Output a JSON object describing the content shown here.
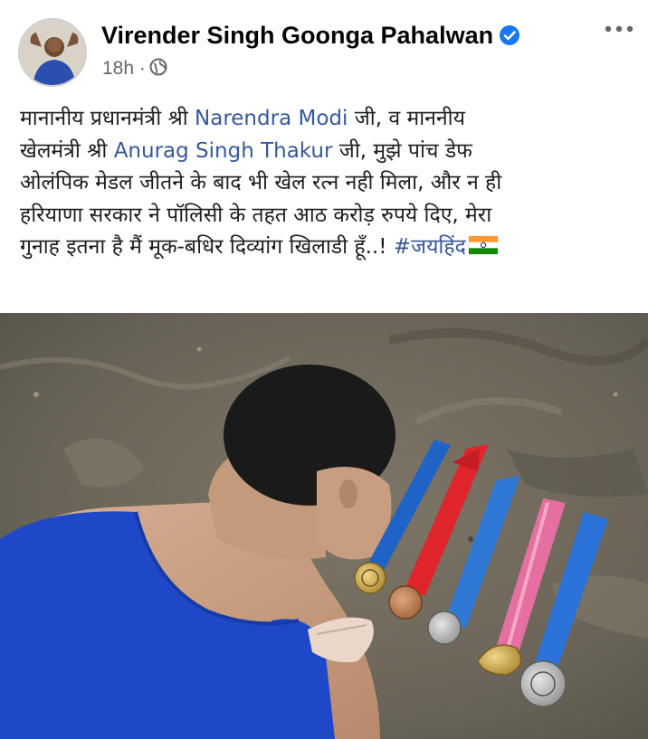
{
  "post": {
    "author": "Virender Singh Goonga Pahalwan",
    "time": "18h ·",
    "text_lines": [
      [
        "मानानीय प्रधानमंत्री श्री ",
        "Narendra Modi",
        " जी, व माननीय"
      ],
      [
        "खेलमंत्री श्री ",
        "Anurag Singh Thakur",
        " जी, मुझे पांच डेफ"
      ],
      [
        "ओलंपिक मेडल जीतने के बाद भी खेल रत्न नही मिला, और न ही"
      ],
      [
        "हरियाणा सरकार ने पॉलिसी के तहत आठ करोड़ रुपये दिए, मेरा"
      ],
      [
        "गुनाह इतना है मैं मूक-बधिर दिव्यांग खिलाडी हूँ..! ",
        "#जयहिंद"
      ]
    ]
  },
  "icons": {
    "verified": "verified-badge-icon",
    "globe": "globe-icon",
    "more": "more-options-icon",
    "flag": "india-flag-emoji"
  },
  "colors": {
    "link": "#385898",
    "verified": "#1877f2",
    "meta": "#65676b",
    "medal_ribbons": [
      "#1f63c7",
      "#e0262c",
      "#2f78d4",
      "#e56fa0",
      "#2b73d8"
    ]
  }
}
